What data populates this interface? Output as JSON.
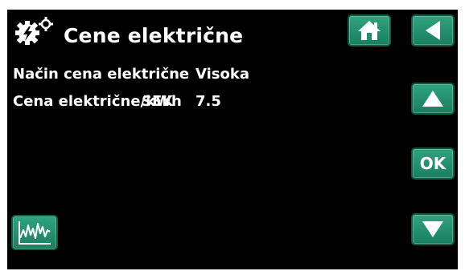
{
  "header": {
    "title": "Cene električne",
    "icon": "electricity-price-settings-icon"
  },
  "rows": [
    {
      "label": "Način cena električne",
      "value": "Visoka"
    },
    {
      "label": "Cena električne/kWh",
      "value": "7.5"
    }
  ],
  "currency_overlay": "SEK",
  "buttons": {
    "home": {
      "icon": "home-icon"
    },
    "back": {
      "icon": "back-arrow-icon"
    },
    "up": {
      "icon": "up-arrow-icon"
    },
    "ok": {
      "label": "OK"
    },
    "down": {
      "icon": "down-arrow-icon"
    },
    "graph": {
      "icon": "graph-icon"
    }
  },
  "colors": {
    "background": "#000000",
    "button": "#1f8f6a",
    "text": "#ffffff"
  }
}
